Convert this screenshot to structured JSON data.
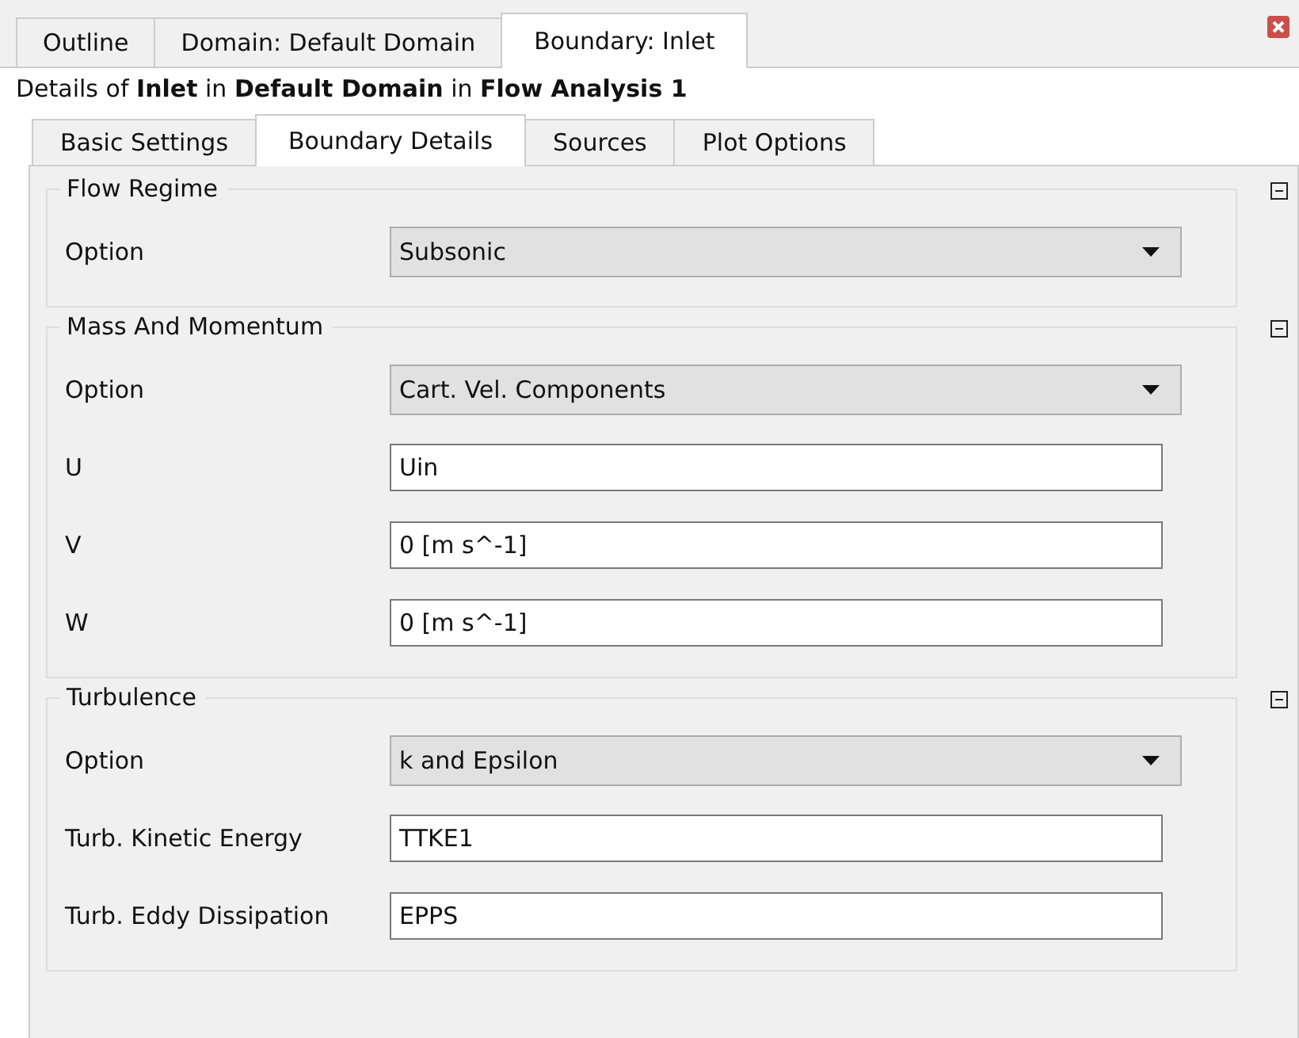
{
  "top_tabs": [
    {
      "label": "Outline",
      "selected": false
    },
    {
      "label": "Domain: Default Domain",
      "selected": false
    },
    {
      "label": "Boundary: Inlet",
      "selected": true
    }
  ],
  "details": "Details of **Inlet** in **Default Domain** in **Flow Analysis 1**",
  "tabs": [
    {
      "label": "Basic Settings",
      "selected": false
    },
    {
      "label": "Boundary Details",
      "selected": true
    },
    {
      "label": "Sources",
      "selected": false
    },
    {
      "label": "Plot Options",
      "selected": false
    }
  ],
  "sections": [
    {
      "title": "Flow Regime",
      "expanded": true,
      "fields": [
        {
          "label": "Option",
          "kind": "dropdown",
          "value": "Subsonic"
        }
      ]
    },
    {
      "title": "Mass And Momentum",
      "expanded": true,
      "fields": [
        {
          "label": "Option",
          "kind": "dropdown",
          "value": "Cart. Vel. Components"
        },
        {
          "label": "U",
          "kind": "text",
          "value": "Uin"
        },
        {
          "label": "V",
          "kind": "text",
          "value": "0 [m s^-1]"
        },
        {
          "label": "W",
          "kind": "text",
          "value": "0 [m s^-1]"
        }
      ]
    },
    {
      "title": "Turbulence",
      "expanded": true,
      "fields": [
        {
          "label": "Option",
          "kind": "dropdown",
          "value": "k and Epsilon"
        },
        {
          "label": "Turb. Kinetic Energy",
          "kind": "text",
          "value": "TTKE1"
        },
        {
          "label": "Turb. Eddy Dissipation",
          "kind": "text",
          "value": "EPPS"
        }
      ]
    }
  ]
}
